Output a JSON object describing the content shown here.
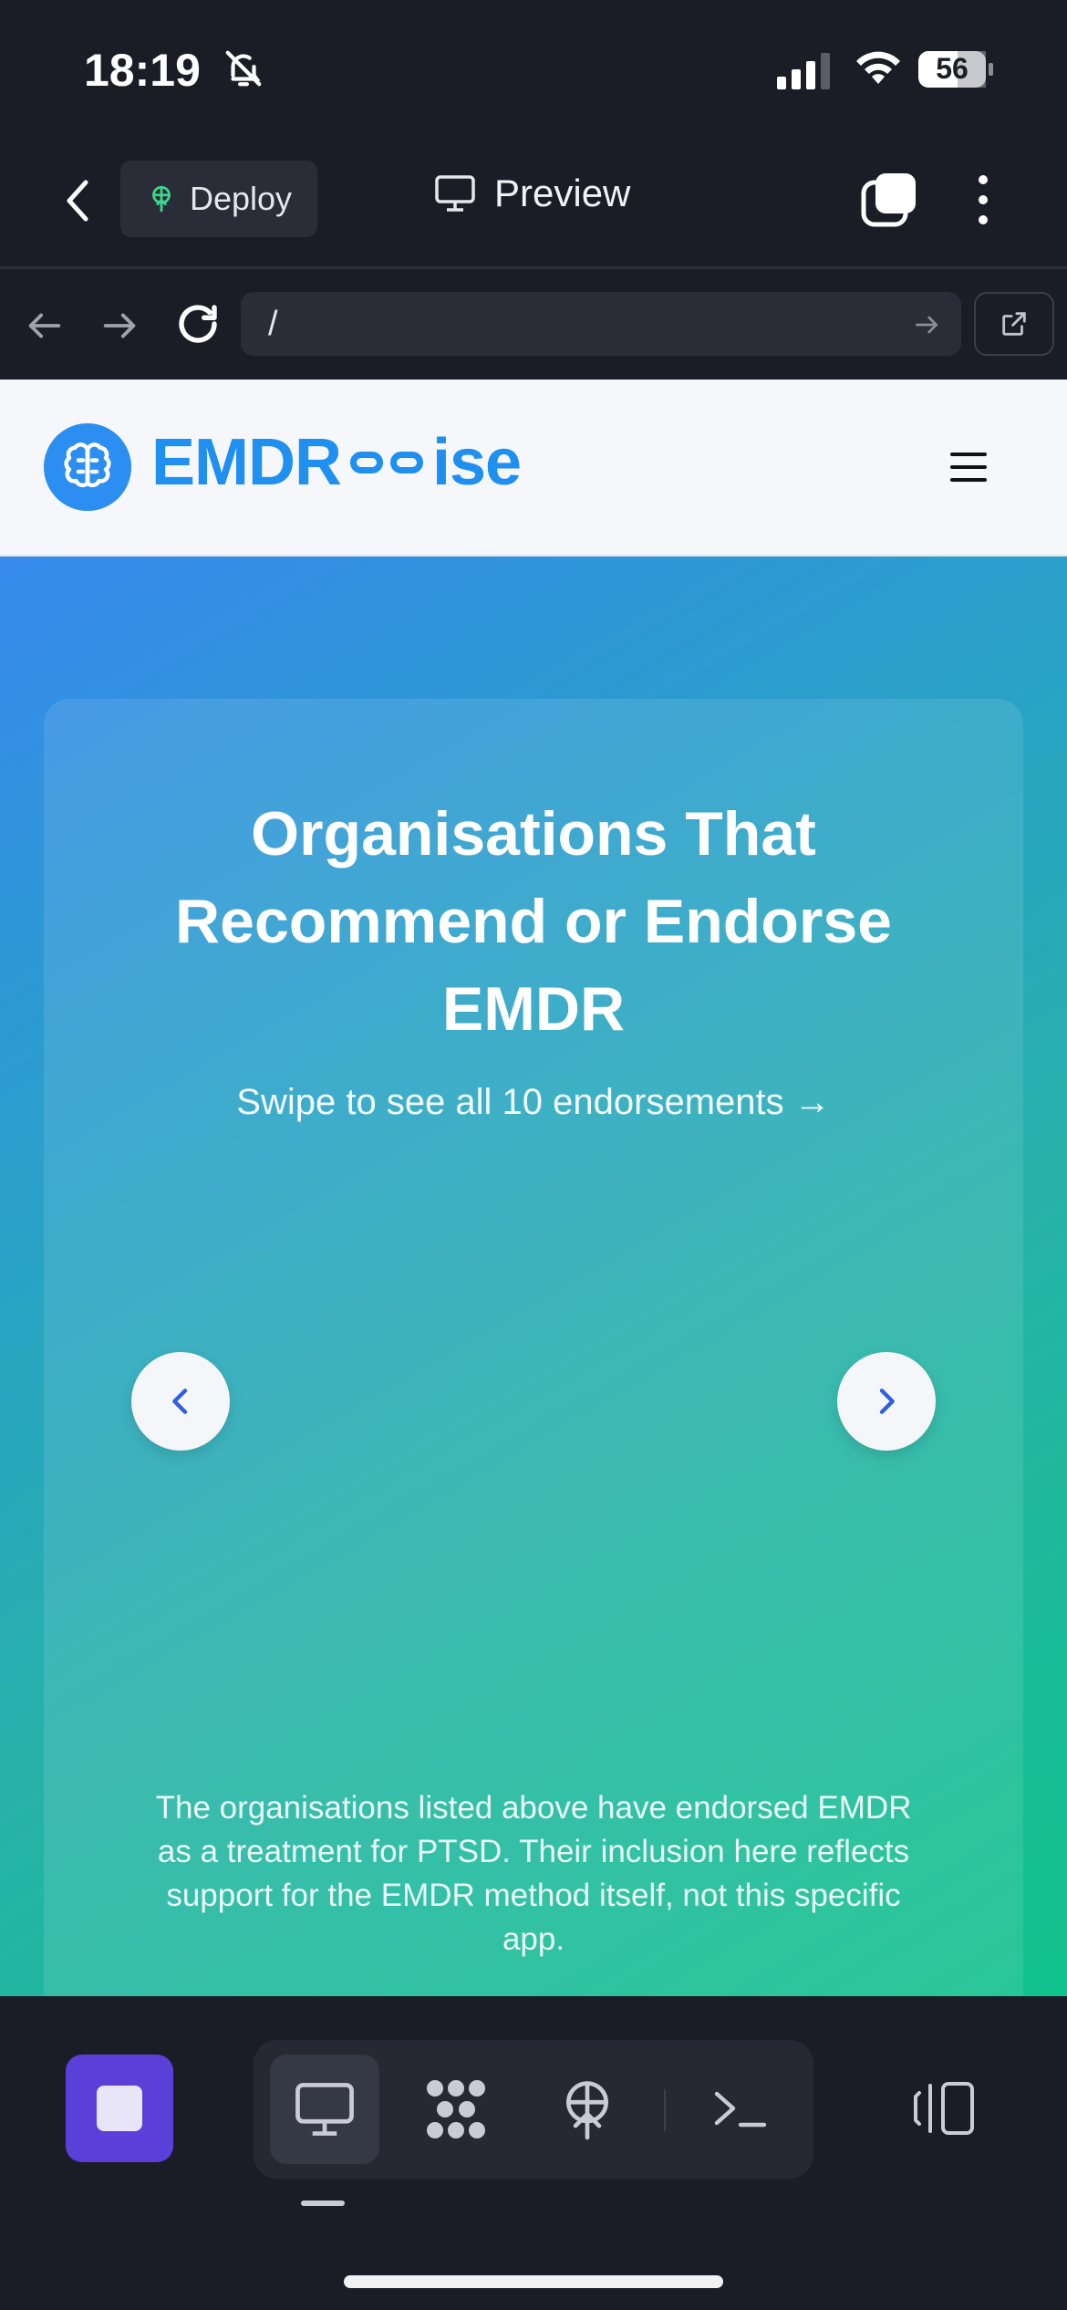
{
  "status_bar": {
    "time": "18:19",
    "battery": "56"
  },
  "toolbar": {
    "deploy_label": "Deploy",
    "preview_label": "Preview"
  },
  "url_bar": {
    "url": "/"
  },
  "site": {
    "brand_prefix": "EMDR",
    "brand_suffix": "ise",
    "hero": {
      "title": "Organisations That Recommend or Endorse EMDR",
      "subtitle": "Swipe to see all 10 endorsements →",
      "disclaimer": "The organisations listed above have endorsed EMDR as a treatment for PTSD. Their inclusion here reflects support for the EMDR method itself, not this specific app."
    }
  },
  "dock": {
    "tools": [
      "preview-icon",
      "packages-icon",
      "deploy-icon",
      "terminal-icon"
    ],
    "active_tool": "preview"
  },
  "colors": {
    "app_bg": "#1b1d26",
    "brand_blue": "#1f8ff0",
    "stop_purple": "#5b3fd9",
    "deploy_green": "#3dd68c",
    "carousel_arrow": "#2f5fe0"
  }
}
